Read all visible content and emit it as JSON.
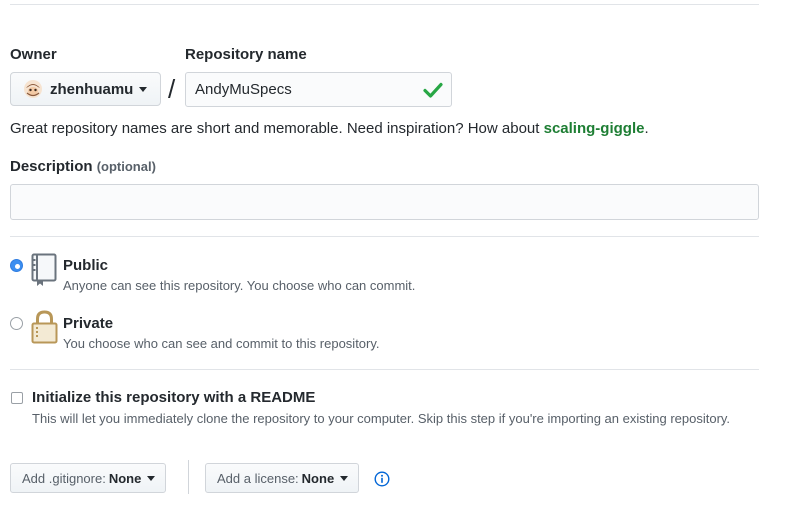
{
  "owner": {
    "label": "Owner",
    "username": "zhenhuamu",
    "avatar_icon": "octocat-avatar"
  },
  "repository": {
    "label": "Repository name",
    "value": "AndyMuSpecs",
    "separator": "/",
    "valid_icon": "check-icon"
  },
  "hint": {
    "text": "Great repository names are short and memorable. Need inspiration? How about ",
    "suggestion": "scaling-giggle",
    "suffix": "."
  },
  "description": {
    "label": "Description",
    "optional": "(optional)",
    "value": "",
    "placeholder": ""
  },
  "visibility": {
    "selected": "public",
    "public": {
      "title": "Public",
      "desc": "Anyone can see this repository. You choose who can commit.",
      "icon": "repo-book-icon"
    },
    "private": {
      "title": "Private",
      "desc": "You choose who can see and commit to this repository.",
      "icon": "lock-icon"
    }
  },
  "readme": {
    "label": "Initialize this repository with a README",
    "desc": "This will let you immediately clone the repository to your computer. Skip this step if you're importing an existing repository.",
    "checked": false
  },
  "gitignore": {
    "label": "Add .gitignore:",
    "value": "None"
  },
  "license": {
    "label": "Add a license:",
    "value": "None"
  },
  "colors": {
    "accent_blue": "#0366d6",
    "success_green": "#28a745",
    "border": "#d1d5da",
    "muted_text": "#586069"
  }
}
